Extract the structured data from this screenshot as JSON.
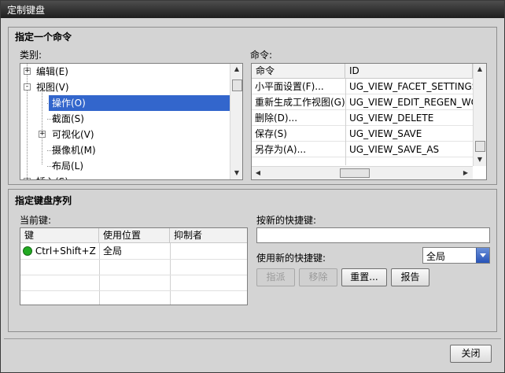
{
  "window": {
    "title": "定制键盘"
  },
  "command_group": {
    "title": "指定一个命令",
    "category_label": "类别:",
    "command_label": "命令:",
    "tree": [
      {
        "label": "编辑(E)",
        "level": 0,
        "expander": "+"
      },
      {
        "label": "视图(V)",
        "level": 0,
        "expander": "-"
      },
      {
        "label": "操作(O)",
        "level": 1,
        "selected": true
      },
      {
        "label": "截面(S)",
        "level": 1
      },
      {
        "label": "可视化(V)",
        "level": 1,
        "expander": "+"
      },
      {
        "label": "摄像机(M)",
        "level": 1
      },
      {
        "label": "布局(L)",
        "level": 1
      },
      {
        "label": "插入(S)",
        "level": 0,
        "expander": "+"
      }
    ],
    "commands_table": {
      "headers": [
        "命令",
        "ID"
      ],
      "rows": [
        [
          "小平面设置(F)...",
          "UG_VIEW_FACET_SETTINGS"
        ],
        [
          "重新生成工作视图(G)",
          "UG_VIEW_EDIT_REGEN_WO..."
        ],
        [
          "删除(D)...",
          "UG_VIEW_DELETE"
        ],
        [
          "保存(S)",
          "UG_VIEW_SAVE"
        ],
        [
          "另存为(A)...",
          "UG_VIEW_SAVE_AS"
        ]
      ]
    }
  },
  "keyboard_group": {
    "title": "指定键盘序列",
    "current_keys_label": "当前键:",
    "keys_table": {
      "headers": [
        "键",
        "使用位置",
        "抑制者"
      ],
      "rows": [
        {
          "key": "Ctrl+Shift+Z",
          "where": "全局",
          "suppressor": "",
          "status_color": "#22aa22"
        }
      ]
    },
    "new_shortcut_label": "按新的快捷键:",
    "new_shortcut_value": "",
    "use_shortcut_label": "使用新的快捷键:",
    "scope_value": "全局",
    "buttons": {
      "assign": "指派",
      "remove": "移除",
      "reset": "重置...",
      "report": "报告"
    }
  },
  "footer": {
    "close": "关闭"
  }
}
